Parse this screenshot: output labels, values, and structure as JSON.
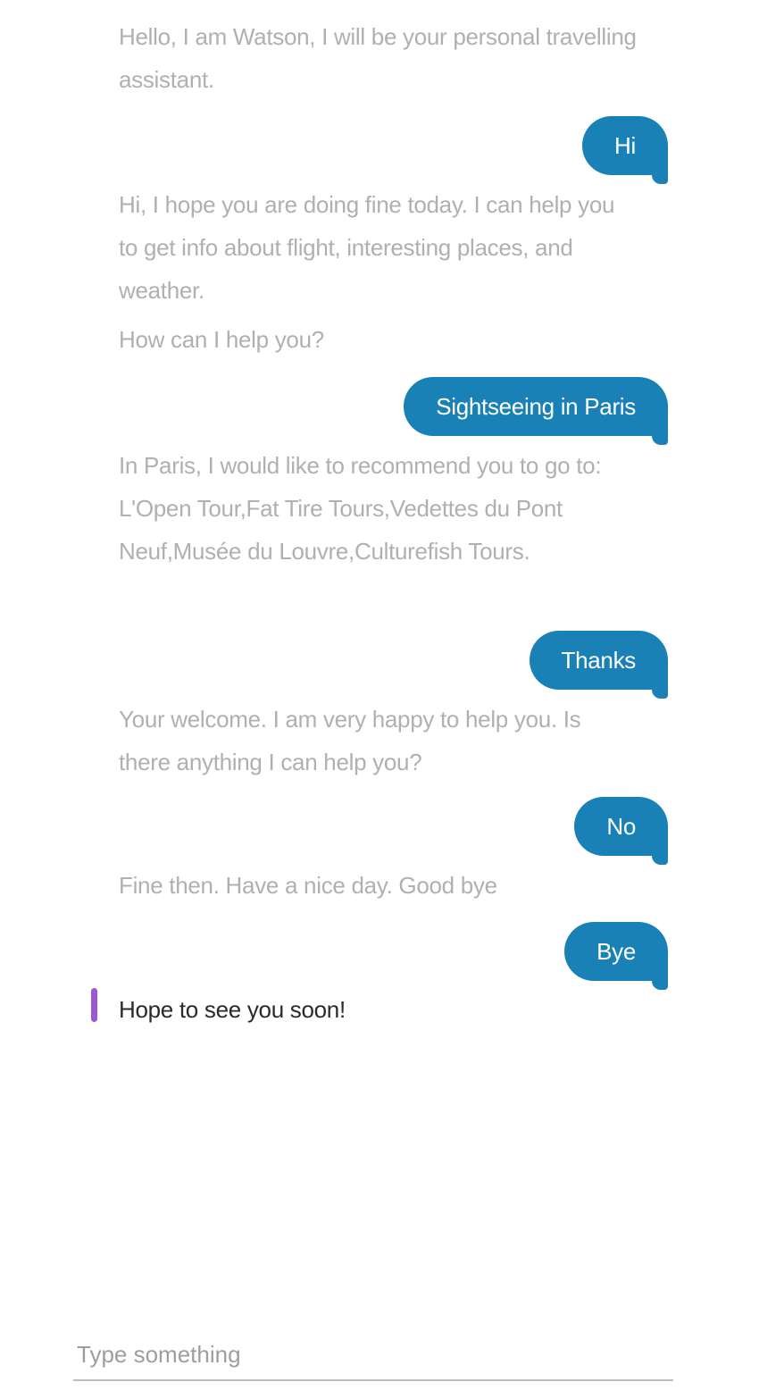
{
  "conversation": {
    "messages": [
      {
        "from": "bot",
        "text": "Hello, I am Watson, I will be your personal travelling assistant."
      },
      {
        "from": "user",
        "text": "Hi"
      },
      {
        "from": "bot",
        "text": "Hi, I hope you are doing fine today. I can help you to get info about flight, interesting places, and weather."
      },
      {
        "from": "bot",
        "text": "How can I help you?"
      },
      {
        "from": "user",
        "text": "Sightseeing in Paris"
      },
      {
        "from": "bot",
        "text": "In Paris, I would like to recommend you to go to: L'Open Tour,Fat Tire Tours,Vedettes du Pont Neuf,Musée du Louvre,Culturefish Tours."
      },
      {
        "from": "user",
        "text": "Thanks"
      },
      {
        "from": "bot",
        "text": "Your welcome. I am very happy to help you. Is there anything I can help you?"
      },
      {
        "from": "user",
        "text": "No"
      },
      {
        "from": "bot",
        "text": "Fine then. Have a nice day. Good bye"
      },
      {
        "from": "user",
        "text": "Bye"
      },
      {
        "from": "bot",
        "text": "Hope to see you soon!",
        "current": true
      }
    ]
  },
  "input": {
    "value": "",
    "placeholder": "Type something"
  },
  "colors": {
    "user_bubble": "#1981b5",
    "bot_text_old": "#b0b0b0",
    "bot_text_current": "#2a2a2a",
    "indicator": "#9b59d0"
  }
}
